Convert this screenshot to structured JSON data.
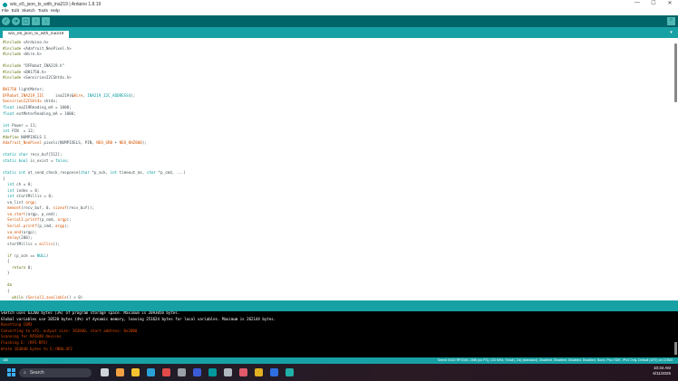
{
  "window": {
    "title": "wio_e5_json_tx_with_ina219 | Arduino 1.8.19",
    "controls": [
      "—",
      "☐",
      "✕"
    ]
  },
  "menu": [
    "File",
    "Edit",
    "Sketch",
    "Tools",
    "Help"
  ],
  "toolbar": {
    "verify": "✓",
    "upload": "➜",
    "new": "▢",
    "open": "↑",
    "save": "↓",
    "serial_monitor": "⌕"
  },
  "tab": {
    "name": "wio_e5_json_tx_with_ina219",
    "menu": "▾"
  },
  "code": [
    [
      [
        "#include",
        "pp"
      ],
      [
        " <Arduino.h>",
        ""
      ]
    ],
    [
      [
        "#include",
        "pp"
      ],
      [
        " <Adafruit_NeoPixel.h>",
        ""
      ]
    ],
    [
      [
        "#include",
        "pp"
      ],
      [
        " <Wire.h>",
        ""
      ]
    ],
    [],
    [
      [
        "#include",
        "pp"
      ],
      [
        " \"DFRobot_INA219.h\"",
        ""
      ]
    ],
    [
      [
        "#include",
        "pp"
      ],
      [
        " <BH1750.h>",
        ""
      ]
    ],
    [
      [
        "#include",
        "pp"
      ],
      [
        " <SensirionI2CSht4x.h>",
        ""
      ]
    ],
    [],
    [
      [
        "BH1750",
        "fn"
      ],
      [
        " lightMeter;",
        ""
      ]
    ],
    [
      [
        "DFRobot_INA219_IIC",
        "fn"
      ],
      [
        "     ina219(&",
        "",
        ""
      ],
      [
        "Wire",
        "fn"
      ],
      [
        ", ",
        ""
      ],
      [
        "INA219_I2C_ADDRESS4",
        "kw"
      ],
      [
        ");",
        ""
      ]
    ],
    [
      [
        "SensirionI2CSht4x",
        "fn"
      ],
      [
        " sht4x;",
        ""
      ]
    ],
    [
      [
        "float",
        "kw"
      ],
      [
        " ina219Reading_mA = 1000;",
        ""
      ]
    ],
    [
      [
        "float",
        "kw"
      ],
      [
        " extMeterReading_mA = 1000;",
        ""
      ]
    ],
    [],
    [
      [
        "int",
        "kw"
      ],
      [
        " Power = 11;",
        ""
      ]
    ],
    [
      [
        "int",
        "kw"
      ],
      [
        " PIN  = 12;",
        ""
      ]
    ],
    [
      [
        "#define",
        "pp"
      ],
      [
        " NUMPIXELS 1",
        ""
      ]
    ],
    [
      [
        "Adafruit_NeoPixel",
        "fn"
      ],
      [
        " pixels(NUMPIXELS, PIN, ",
        ""
      ],
      [
        "NEO_GRB",
        "fn"
      ],
      [
        " + ",
        ""
      ],
      [
        "NEO_KHZ800",
        "fn"
      ],
      [
        ");",
        ""
      ]
    ],
    [],
    [
      [
        "static",
        "kw"
      ],
      [
        " ",
        ""
      ],
      [
        "char",
        "kw"
      ],
      [
        " recv_buf[512];",
        ""
      ]
    ],
    [
      [
        "static",
        "kw"
      ],
      [
        " ",
        ""
      ],
      [
        "bool",
        "kw"
      ],
      [
        " is_exist = ",
        ""
      ],
      [
        "false",
        "kw"
      ],
      [
        ";",
        ""
      ]
    ],
    [],
    [
      [
        "static",
        "kw"
      ],
      [
        " ",
        ""
      ],
      [
        "int",
        "kw"
      ],
      [
        " at_send_check_response(",
        ""
      ],
      [
        "char",
        "kw"
      ],
      [
        " *p_ack, ",
        ""
      ],
      [
        "int",
        "kw"
      ],
      [
        " timeout_ms, ",
        ""
      ],
      [
        "char",
        "kw"
      ],
      [
        " *p_cmd, ...)",
        ""
      ]
    ],
    [
      [
        "{",
        ""
      ]
    ],
    [
      [
        "  ",
        ""
      ],
      [
        "int",
        "kw"
      ],
      [
        " ch = 0;",
        ""
      ]
    ],
    [
      [
        "  ",
        ""
      ],
      [
        "int",
        "kw"
      ],
      [
        " index = 0;",
        ""
      ]
    ],
    [
      [
        "  ",
        ""
      ],
      [
        "int",
        "kw"
      ],
      [
        " startMillis = 0;",
        ""
      ]
    ],
    [
      [
        "  va_list ",
        ""
      ],
      [
        "argp",
        "fn"
      ],
      [
        ";",
        ""
      ]
    ],
    [
      [
        "  ",
        ""
      ],
      [
        "memset",
        "fn"
      ],
      [
        "(recv_buf, 0, ",
        ""
      ],
      [
        "sizeof",
        "fn"
      ],
      [
        "(recv_buf));",
        ""
      ]
    ],
    [
      [
        "  ",
        ""
      ],
      [
        "va_start",
        "fn"
      ],
      [
        "(argp, p_cmd);",
        ""
      ]
    ],
    [
      [
        "  ",
        ""
      ],
      [
        "Serial1",
        "fn"
      ],
      [
        ".",
        ""
      ],
      [
        "printf",
        "fn"
      ],
      [
        "(p_cmd, ",
        ""
      ],
      [
        "argp",
        "fn"
      ],
      [
        ");",
        ""
      ]
    ],
    [
      [
        "  ",
        ""
      ],
      [
        "Serial",
        "fn"
      ],
      [
        ".",
        ""
      ],
      [
        "printf",
        "fn"
      ],
      [
        "(p_cmd, ",
        ""
      ],
      [
        "argp",
        "fn"
      ],
      [
        ");",
        ""
      ]
    ],
    [
      [
        "  ",
        ""
      ],
      [
        "va_end",
        "fn"
      ],
      [
        "(argp);",
        ""
      ]
    ],
    [
      [
        "  ",
        ""
      ],
      [
        "delay",
        "fn"
      ],
      [
        "(200);",
        ""
      ]
    ],
    [
      [
        "  startMillis = ",
        ""
      ],
      [
        "millis",
        "fn"
      ],
      [
        "();",
        ""
      ]
    ],
    [],
    [
      [
        "  ",
        ""
      ],
      [
        "if",
        "pp"
      ],
      [
        " (p_ack == ",
        ""
      ],
      [
        "NULL",
        "kw"
      ],
      [
        ")",
        ""
      ]
    ],
    [
      [
        "  {",
        ""
      ]
    ],
    [
      [
        "    ",
        ""
      ],
      [
        "return",
        "pp"
      ],
      [
        " 0;",
        ""
      ]
    ],
    [
      [
        "  }",
        ""
      ]
    ],
    [],
    [
      [
        "  ",
        ""
      ],
      [
        "do",
        "pp"
      ]
    ],
    [
      [
        "  {",
        ""
      ]
    ],
    [
      [
        "    ",
        ""
      ],
      [
        "while",
        "pp"
      ],
      [
        " (",
        ""
      ],
      [
        "Serial1",
        "fn"
      ],
      [
        ".",
        ""
      ],
      [
        "available",
        "fn"
      ],
      [
        "() > 0)",
        ""
      ]
    ]
  ],
  "console": [
    {
      "text": "Sketch uses 63200 bytes (3%) of program storage space. Maximum is 2093056 bytes.",
      "type": "info"
    },
    {
      "text": "Global variables use 10520 bytes (4%) of dynamic memory, leaving 251624 bytes for local variables. Maximum is 262144 bytes.",
      "type": "info"
    },
    {
      "text": "Resetting COM3",
      "type": "err"
    },
    {
      "text": "Converting to uf2, output size: 163840, start address: 0x2000",
      "type": "err"
    },
    {
      "text": "Scanning for RP2040 devices",
      "type": "err"
    },
    {
      "text": "Flashing E: (RPI-RP2)",
      "type": "err"
    },
    {
      "text": "Wrote 163840 bytes to E:/NEW.UF2",
      "type": "err"
    }
  ],
  "status": {
    "line": "180",
    "board": "Seeed XIAO RP2040, 2MB (no FS), 133 MHz, Small (-Os) (standard), Disabled, Disabled, Disabled, Disabled, None, Pico SDK, IPv4 Only, Default (UF2) on COM3"
  },
  "taskbar": {
    "search": "Search",
    "time": "10:34 AM",
    "date": "6/11/2025",
    "apps": [
      {
        "name": "task-view",
        "color": "#cfd3da"
      },
      {
        "name": "app-widget",
        "color": "#f0a040"
      },
      {
        "name": "file-explorer",
        "color": "#f4c430"
      },
      {
        "name": "edge",
        "color": "#2aa0d8"
      },
      {
        "name": "store",
        "color": "#e04a4a"
      },
      {
        "name": "settings",
        "color": "#9aa0a8"
      },
      {
        "name": "app-ae",
        "color": "#3a5ad8"
      },
      {
        "name": "arduino",
        "color": "#00979c"
      },
      {
        "name": "app-monitor",
        "color": "#b0b8c0"
      },
      {
        "name": "snipping-tool",
        "color": "#e05a6a"
      },
      {
        "name": "app-yellow",
        "color": "#e0b020"
      },
      {
        "name": "uipath",
        "color": "#2f6ee0"
      },
      {
        "name": "arduino-ide",
        "color": "#20b0a8"
      }
    ]
  }
}
